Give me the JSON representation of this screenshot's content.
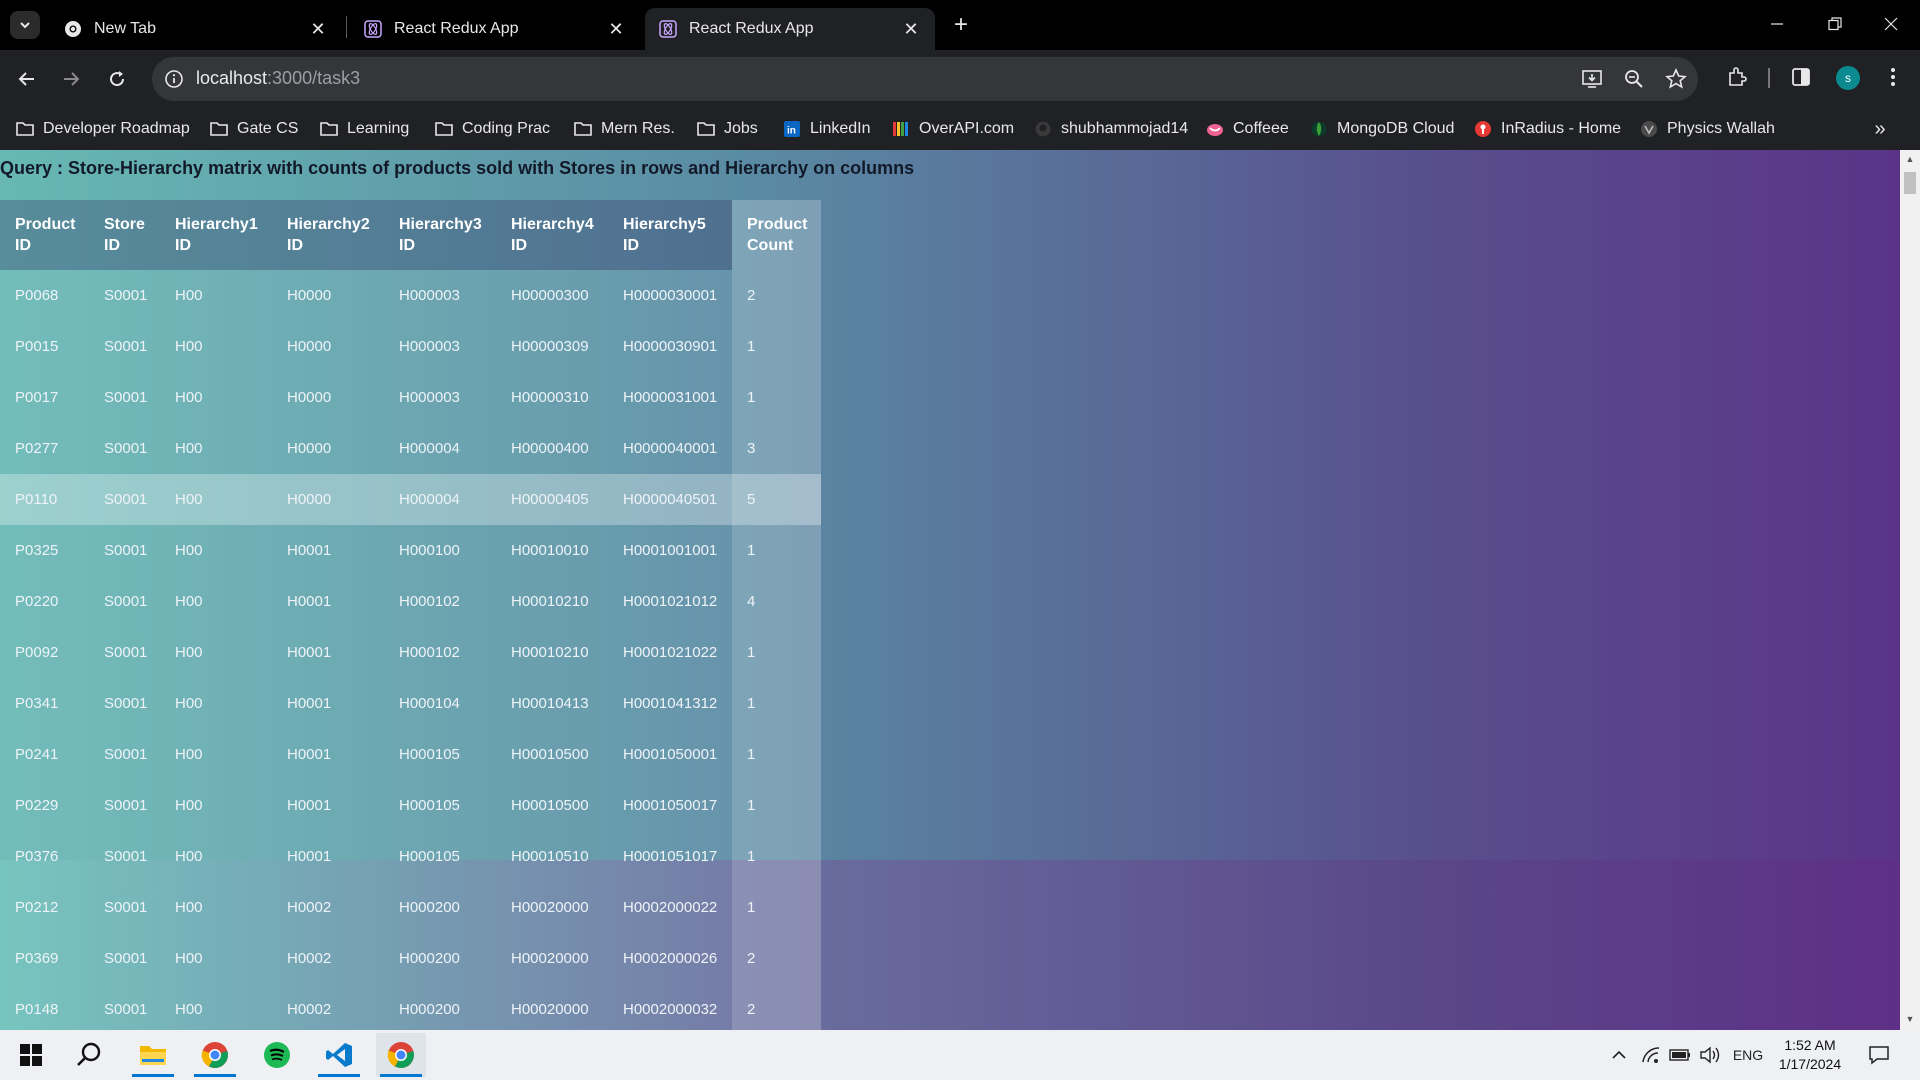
{
  "browser": {
    "tabs": [
      {
        "title": "New Tab",
        "icon": "chrome-icon",
        "active": false
      },
      {
        "title": "React Redux App",
        "icon": "react-redux-icon",
        "active": false
      },
      {
        "title": "React Redux App",
        "icon": "react-redux-icon",
        "active": true
      }
    ],
    "address": {
      "host": "localhost",
      "path": ":3000/task3"
    },
    "profile_initial": "s",
    "bookmarks": [
      {
        "label": "Developer Roadmap",
        "icon": "folder-icon"
      },
      {
        "label": "Gate CS",
        "icon": "folder-icon"
      },
      {
        "label": "Learning",
        "icon": "folder-icon"
      },
      {
        "label": "Coding Prac",
        "icon": "folder-icon"
      },
      {
        "label": "Mern Res.",
        "icon": "folder-icon"
      },
      {
        "label": "Jobs",
        "icon": "folder-icon"
      },
      {
        "label": "LinkedIn",
        "icon": "linkedin-icon"
      },
      {
        "label": "OverAPI.com",
        "icon": "overapi-icon"
      },
      {
        "label": "shubhammojad14",
        "icon": "github-icon"
      },
      {
        "label": "Coffeee",
        "icon": "coffee-icon"
      },
      {
        "label": "MongoDB Cloud",
        "icon": "mongodb-icon"
      },
      {
        "label": "InRadius - Home",
        "icon": "inradius-icon"
      },
      {
        "label": "Physics Wallah",
        "icon": "physics-wallah-icon"
      }
    ]
  },
  "page": {
    "query": "Query : Store-Hierarchy matrix with counts of products sold with Stores in rows and Hierarchy on columns",
    "table": {
      "headers": [
        [
          "Product",
          "ID"
        ],
        [
          "Store",
          "ID"
        ],
        [
          "Hierarchy1",
          "ID"
        ],
        [
          "Hierarchy2",
          "ID"
        ],
        [
          "Hierarchy3",
          "ID"
        ],
        [
          "Hierarchy4",
          "ID"
        ],
        [
          "Hierarchy5",
          "ID"
        ],
        [
          "Product",
          "Count"
        ]
      ],
      "rows": [
        [
          "P0068",
          "S0001",
          "H00",
          "H0000",
          "H000003",
          "H00000300",
          "H0000030001",
          "2"
        ],
        [
          "P0015",
          "S0001",
          "H00",
          "H0000",
          "H000003",
          "H00000309",
          "H0000030901",
          "1"
        ],
        [
          "P0017",
          "S0001",
          "H00",
          "H0000",
          "H000003",
          "H00000310",
          "H0000031001",
          "1"
        ],
        [
          "P0277",
          "S0001",
          "H00",
          "H0000",
          "H000004",
          "H00000400",
          "H0000040001",
          "3"
        ],
        [
          "P0110",
          "S0001",
          "H00",
          "H0000",
          "H000004",
          "H00000405",
          "H0000040501",
          "5"
        ],
        [
          "P0325",
          "S0001",
          "H00",
          "H0001",
          "H000100",
          "H00010010",
          "H0001001001",
          "1"
        ],
        [
          "P0220",
          "S0001",
          "H00",
          "H0001",
          "H000102",
          "H00010210",
          "H0001021012",
          "4"
        ],
        [
          "P0092",
          "S0001",
          "H00",
          "H0001",
          "H000102",
          "H00010210",
          "H0001021022",
          "1"
        ],
        [
          "P0341",
          "S0001",
          "H00",
          "H0001",
          "H000104",
          "H00010413",
          "H0001041312",
          "1"
        ],
        [
          "P0241",
          "S0001",
          "H00",
          "H0001",
          "H000105",
          "H00010500",
          "H0001050001",
          "1"
        ],
        [
          "P0229",
          "S0001",
          "H00",
          "H0001",
          "H000105",
          "H00010500",
          "H0001050017",
          "1"
        ],
        [
          "P0376",
          "S0001",
          "H00",
          "H0001",
          "H000105",
          "H00010510",
          "H0001051017",
          "1"
        ],
        [
          "P0212",
          "S0001",
          "H00",
          "H0002",
          "H000200",
          "H00020000",
          "H0002000022",
          "1"
        ],
        [
          "P0369",
          "S0001",
          "H00",
          "H0002",
          "H000200",
          "H00020000",
          "H0002000026",
          "2"
        ],
        [
          "P0148",
          "S0001",
          "H00",
          "H0002",
          "H000200",
          "H00020000",
          "H0002000032",
          "2"
        ]
      ],
      "highlighted_row": 4
    }
  },
  "taskbar": {
    "apps": [
      {
        "name": "start-icon"
      },
      {
        "name": "search-icon"
      },
      {
        "name": "file-explorer-icon"
      },
      {
        "name": "chrome-icon"
      },
      {
        "name": "spotify-icon"
      },
      {
        "name": "vscode-icon"
      },
      {
        "name": "chrome-icon"
      }
    ],
    "language": "ENG",
    "time": "1:52 AM",
    "date": "1/17/2024"
  }
}
